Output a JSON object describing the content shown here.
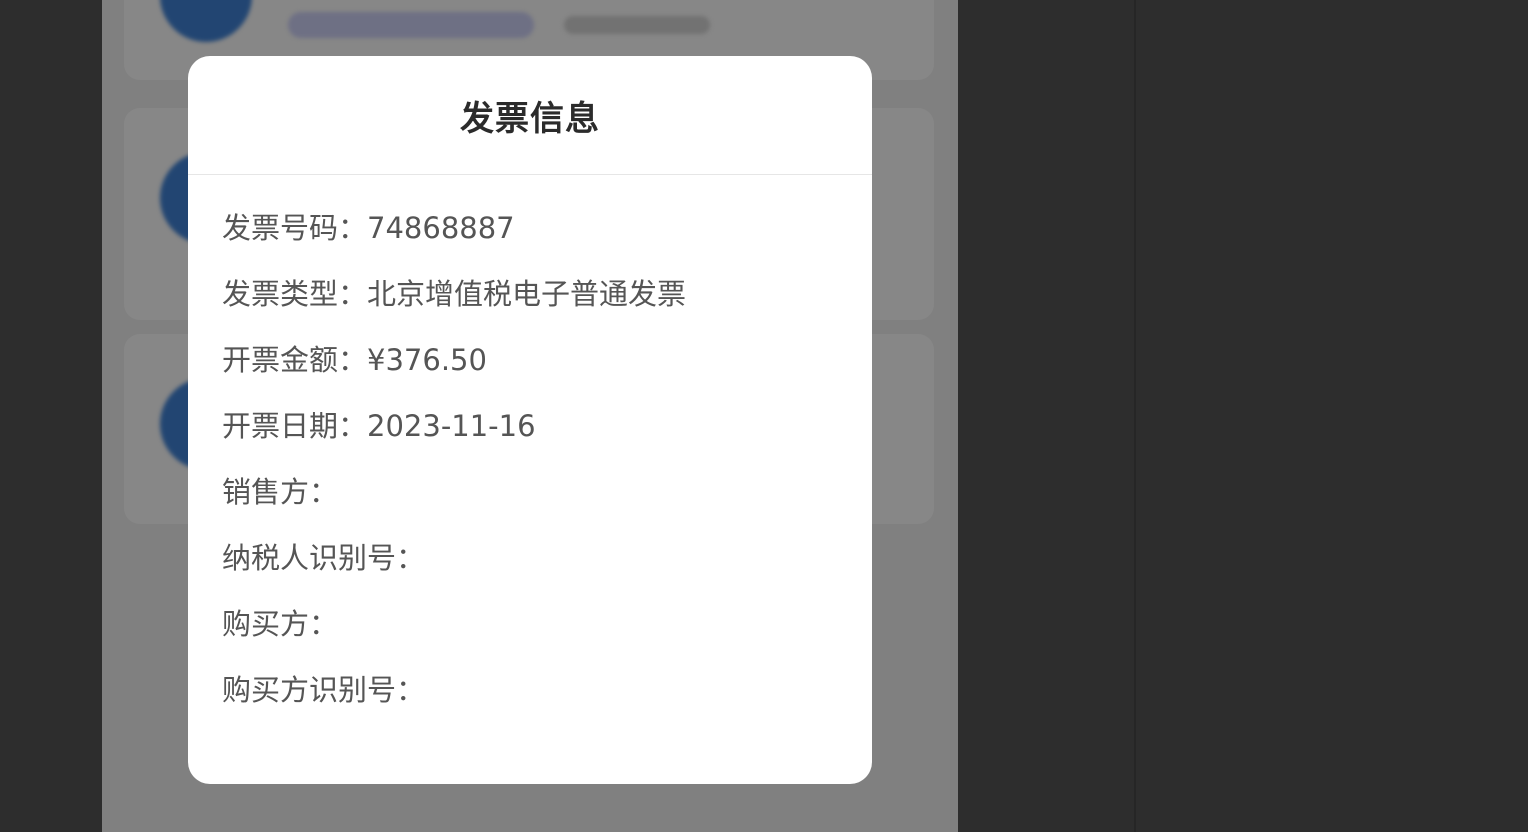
{
  "modal": {
    "title": "发票信息",
    "fields": [
      {
        "label": "发票号码：",
        "value": "74868887"
      },
      {
        "label": "发票类型：",
        "value": "北京增值税电子普通发票"
      },
      {
        "label": "开票金额：",
        "value": "¥376.50"
      },
      {
        "label": "开票日期：",
        "value": "2023-11-16"
      },
      {
        "label": "销售方：",
        "value": ""
      },
      {
        "label": "纳税人识别号：",
        "value": ""
      },
      {
        "label": "购买方：",
        "value": ""
      },
      {
        "label": "购买方识别号：",
        "value": ""
      }
    ]
  },
  "colors": {
    "overlay": "#000000",
    "modal_background": "#ffffff",
    "outer_background": "#2d2d2d",
    "avatar_blue": "#3f7fd0"
  }
}
